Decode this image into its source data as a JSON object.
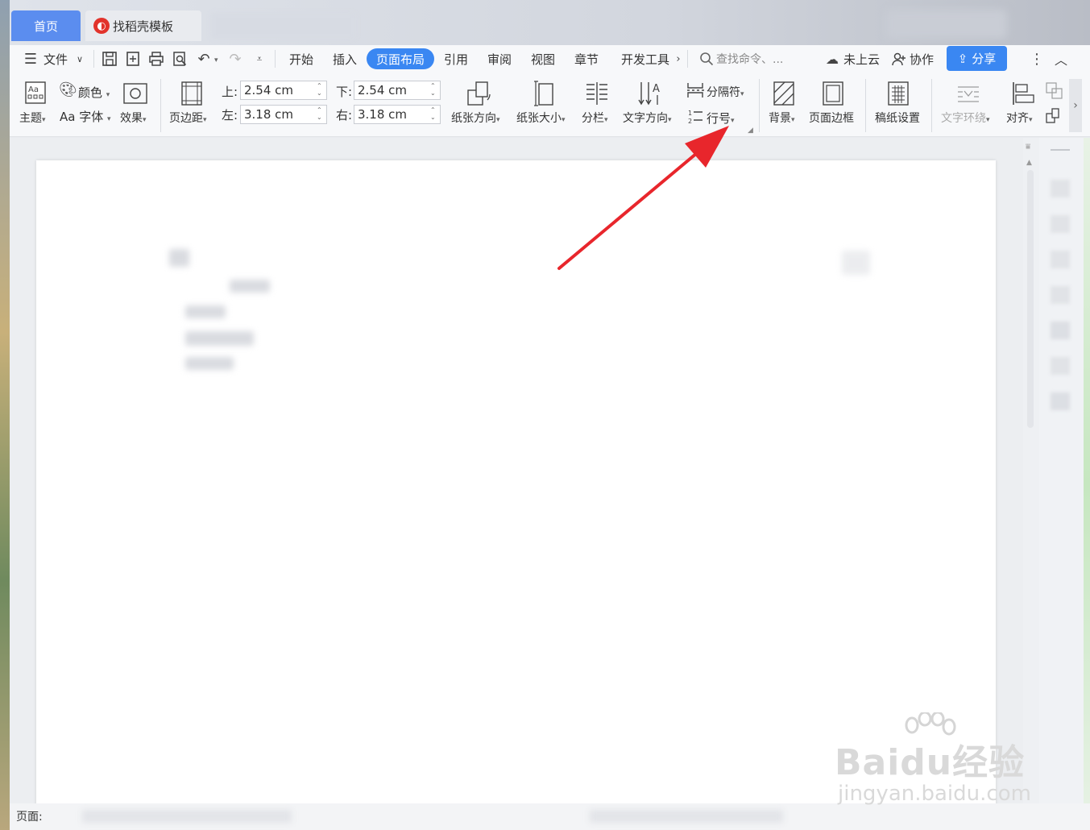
{
  "tabs": {
    "home": "首页",
    "template": "找稻壳模板"
  },
  "menu": {
    "file": "文件",
    "tabs": [
      "开始",
      "插入",
      "页面布局",
      "引用",
      "审阅",
      "视图",
      "章节",
      "开发工具"
    ],
    "active_tab": "页面布局",
    "search_placeholder": "查找命令、...",
    "cloud": "未上云",
    "collab": "协作",
    "share": "分享"
  },
  "ribbon": {
    "theme": "主题",
    "color": "颜色",
    "font": "Aa 字体",
    "effect": "效果",
    "margins": "页边距",
    "top_label": "上:",
    "top_value": "2.54 cm",
    "bottom_label": "下:",
    "bottom_value": "2.54 cm",
    "left_label": "左:",
    "left_value": "3.18 cm",
    "right_label": "右:",
    "right_value": "3.18 cm",
    "orientation": "纸张方向",
    "size": "纸张大小",
    "columns": "分栏",
    "text_direction": "文字方向",
    "breaks": "分隔符",
    "line_numbers": "行号",
    "background": "背景",
    "page_border": "页面边框",
    "manuscript": "稿纸设置",
    "wrap": "文字环绕",
    "align": "对齐"
  },
  "status": {
    "page": "页面: "
  },
  "watermark": {
    "brand": "Baidu经验",
    "url": "jingyan.baidu.com"
  },
  "colors": {
    "accent": "#3a87f2",
    "arrow": "#e8262c"
  }
}
